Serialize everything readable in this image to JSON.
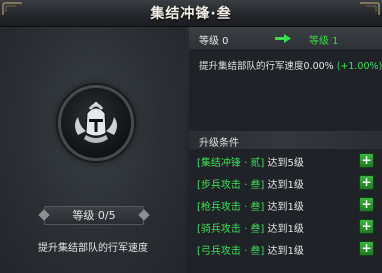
{
  "window": {
    "title": "集结冲锋·叁"
  },
  "skill": {
    "icon": "helmet-emblem-icon",
    "level_label": "等级 0/5",
    "description": "提升集结部队的行军速度"
  },
  "upgrade": {
    "current_level": "等级 0",
    "next_level": "等级 1",
    "effect_text": "提升集结部队的行军速度0.00% ",
    "effect_bonus": "(+1.00%)",
    "colors": {
      "next_level": "#39d54a",
      "bonus": "#3ee05b"
    }
  },
  "requirements": {
    "header": "升级条件",
    "items": [
      {
        "name": "[集结冲锋 · 贰]",
        "condition": " 达到5级"
      },
      {
        "name": "[步兵攻击 · 叁]",
        "condition": " 达到1级"
      },
      {
        "name": "[枪兵攻击 · 叁]",
        "condition": " 达到1级"
      },
      {
        "name": "[骑兵攻击 · 叁]",
        "condition": " 达到1级"
      },
      {
        "name": "[弓兵攻击 · 叁]",
        "condition": " 达到1级"
      }
    ],
    "action_glyph": "+"
  }
}
